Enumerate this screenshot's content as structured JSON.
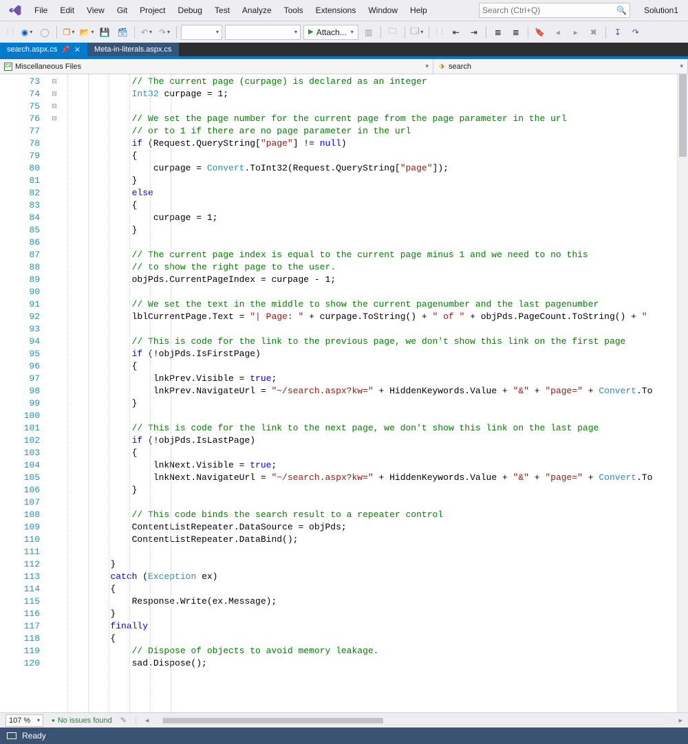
{
  "menu": {
    "items": [
      "File",
      "Edit",
      "View",
      "Git",
      "Project",
      "Debug",
      "Test",
      "Analyze",
      "Tools",
      "Extensions",
      "Window",
      "Help"
    ],
    "search_placeholder": "Search (Ctrl+Q)",
    "solution": "Solution1"
  },
  "toolbar": {
    "attach_label": "Attach..."
  },
  "tabs": [
    {
      "label": "search.aspx.cs",
      "active": true,
      "pinned": true
    },
    {
      "label": "Meta-in-literals.aspx.cs",
      "active": false,
      "pinned": false
    }
  ],
  "nav": {
    "left_label": "Miscellaneous Files",
    "right_label": "search"
  },
  "editor": {
    "first_line": 73,
    "lines": [
      {
        "i": 73,
        "seg": [
          {
            "t": "            ",
            "c": ""
          },
          {
            "t": "// The current page (curpage) is declared as an integer",
            "c": "c-comment"
          }
        ]
      },
      {
        "i": 74,
        "seg": [
          {
            "t": "            ",
            "c": ""
          },
          {
            "t": "Int32",
            "c": "c-type"
          },
          {
            "t": " curpage = ",
            "c": ""
          },
          {
            "t": "1",
            "c": "c-number"
          },
          {
            "t": ";",
            "c": ""
          }
        ]
      },
      {
        "i": 75,
        "seg": [
          {
            "t": "",
            "c": ""
          }
        ]
      },
      {
        "i": 76,
        "seg": [
          {
            "t": "            ",
            "c": ""
          },
          {
            "t": "// We set the page number for the current page from the page parameter in the url",
            "c": "c-comment"
          }
        ]
      },
      {
        "i": 77,
        "seg": [
          {
            "t": "            ",
            "c": ""
          },
          {
            "t": "// or to 1 if there are no page parameter in the url",
            "c": "c-comment"
          }
        ]
      },
      {
        "i": 78,
        "fold": "-",
        "seg": [
          {
            "t": "            ",
            "c": ""
          },
          {
            "t": "if",
            "c": "c-keyword"
          },
          {
            "t": " (Request.QueryString[",
            "c": ""
          },
          {
            "t": "\"page\"",
            "c": "c-string"
          },
          {
            "t": "] != ",
            "c": ""
          },
          {
            "t": "null",
            "c": "c-keyword"
          },
          {
            "t": ")",
            "c": ""
          }
        ]
      },
      {
        "i": 79,
        "seg": [
          {
            "t": "            {",
            "c": ""
          }
        ]
      },
      {
        "i": 80,
        "seg": [
          {
            "t": "                curpage = ",
            "c": ""
          },
          {
            "t": "Convert",
            "c": "c-type"
          },
          {
            "t": ".ToInt32(Request.QueryString[",
            "c": ""
          },
          {
            "t": "\"page\"",
            "c": "c-string"
          },
          {
            "t": "]);",
            "c": ""
          }
        ]
      },
      {
        "i": 81,
        "seg": [
          {
            "t": "            }",
            "c": ""
          }
        ]
      },
      {
        "i": 82,
        "fold": "-",
        "seg": [
          {
            "t": "            ",
            "c": ""
          },
          {
            "t": "else",
            "c": "c-keyword"
          }
        ]
      },
      {
        "i": 83,
        "seg": [
          {
            "t": "            {",
            "c": ""
          }
        ]
      },
      {
        "i": 84,
        "seg": [
          {
            "t": "                curpage = ",
            "c": ""
          },
          {
            "t": "1",
            "c": "c-number"
          },
          {
            "t": ";",
            "c": ""
          }
        ]
      },
      {
        "i": 85,
        "seg": [
          {
            "t": "            }",
            "c": ""
          }
        ]
      },
      {
        "i": 86,
        "seg": [
          {
            "t": "",
            "c": ""
          }
        ]
      },
      {
        "i": 87,
        "seg": [
          {
            "t": "            ",
            "c": ""
          },
          {
            "t": "// The current page index is equal to the current page minus 1 and we need to no this",
            "c": "c-comment"
          }
        ]
      },
      {
        "i": 88,
        "seg": [
          {
            "t": "            ",
            "c": ""
          },
          {
            "t": "// to show the right page to the user.",
            "c": "c-comment"
          }
        ]
      },
      {
        "i": 89,
        "seg": [
          {
            "t": "            objPds.CurrentPageIndex = curpage - ",
            "c": ""
          },
          {
            "t": "1",
            "c": "c-number"
          },
          {
            "t": ";",
            "c": ""
          }
        ]
      },
      {
        "i": 90,
        "seg": [
          {
            "t": "",
            "c": ""
          }
        ]
      },
      {
        "i": 91,
        "seg": [
          {
            "t": "            ",
            "c": ""
          },
          {
            "t": "// We set the text in the middle to show the current pagenumber and the last pagenumber",
            "c": "c-comment"
          }
        ]
      },
      {
        "i": 92,
        "seg": [
          {
            "t": "            lblCurrentPage.Text = ",
            "c": ""
          },
          {
            "t": "\"| Page: \"",
            "c": "c-string"
          },
          {
            "t": " + curpage.ToString() + ",
            "c": ""
          },
          {
            "t": "\" of \"",
            "c": "c-string"
          },
          {
            "t": " + objPds.PageCount.ToString() + ",
            "c": ""
          },
          {
            "t": "\"",
            "c": "c-string"
          }
        ]
      },
      {
        "i": 93,
        "seg": [
          {
            "t": "",
            "c": ""
          }
        ]
      },
      {
        "i": 94,
        "seg": [
          {
            "t": "            ",
            "c": ""
          },
          {
            "t": "// This is code for the link to the previous page, we don't show this link on the first page",
            "c": "c-comment"
          }
        ]
      },
      {
        "i": 95,
        "fold": "-",
        "seg": [
          {
            "t": "            ",
            "c": ""
          },
          {
            "t": "if",
            "c": "c-keyword"
          },
          {
            "t": " (!objPds.IsFirstPage)",
            "c": ""
          }
        ]
      },
      {
        "i": 96,
        "seg": [
          {
            "t": "            {",
            "c": ""
          }
        ]
      },
      {
        "i": 97,
        "seg": [
          {
            "t": "                lnkPrev.Visible = ",
            "c": ""
          },
          {
            "t": "true",
            "c": "c-keyword"
          },
          {
            "t": ";",
            "c": ""
          }
        ]
      },
      {
        "i": 98,
        "seg": [
          {
            "t": "                lnkPrev.NavigateUrl = ",
            "c": ""
          },
          {
            "t": "\"~/search.aspx?kw=\"",
            "c": "c-string"
          },
          {
            "t": " + HiddenKeywords.Value + ",
            "c": ""
          },
          {
            "t": "\"&\"",
            "c": "c-string"
          },
          {
            "t": " + ",
            "c": ""
          },
          {
            "t": "\"page=\"",
            "c": "c-string"
          },
          {
            "t": " + ",
            "c": ""
          },
          {
            "t": "Convert",
            "c": "c-type"
          },
          {
            "t": ".To",
            "c": ""
          }
        ]
      },
      {
        "i": 99,
        "seg": [
          {
            "t": "            }",
            "c": ""
          }
        ]
      },
      {
        "i": 100,
        "seg": [
          {
            "t": "",
            "c": ""
          }
        ]
      },
      {
        "i": 101,
        "seg": [
          {
            "t": "            ",
            "c": ""
          },
          {
            "t": "// This is code for the link to the next page, we don't show this link on the last page",
            "c": "c-comment"
          }
        ]
      },
      {
        "i": 102,
        "fold": "-",
        "seg": [
          {
            "t": "            ",
            "c": ""
          },
          {
            "t": "if",
            "c": "c-keyword"
          },
          {
            "t": " (!objPds.IsLastPage)",
            "c": ""
          }
        ]
      },
      {
        "i": 103,
        "seg": [
          {
            "t": "            {",
            "c": ""
          }
        ]
      },
      {
        "i": 104,
        "seg": [
          {
            "t": "                lnkNext.Visible = ",
            "c": ""
          },
          {
            "t": "true",
            "c": "c-keyword"
          },
          {
            "t": ";",
            "c": ""
          }
        ]
      },
      {
        "i": 105,
        "seg": [
          {
            "t": "                lnkNext.NavigateUrl = ",
            "c": ""
          },
          {
            "t": "\"~/search.aspx?kw=\"",
            "c": "c-string"
          },
          {
            "t": " + HiddenKeywords.Value + ",
            "c": ""
          },
          {
            "t": "\"&\"",
            "c": "c-string"
          },
          {
            "t": " + ",
            "c": ""
          },
          {
            "t": "\"page=\"",
            "c": "c-string"
          },
          {
            "t": " + ",
            "c": ""
          },
          {
            "t": "Convert",
            "c": "c-type"
          },
          {
            "t": ".To",
            "c": ""
          }
        ]
      },
      {
        "i": 106,
        "seg": [
          {
            "t": "            }",
            "c": ""
          }
        ]
      },
      {
        "i": 107,
        "seg": [
          {
            "t": "",
            "c": ""
          }
        ]
      },
      {
        "i": 108,
        "seg": [
          {
            "t": "            ",
            "c": ""
          },
          {
            "t": "// This code binds the search result to a repeater control",
            "c": "c-comment"
          }
        ]
      },
      {
        "i": 109,
        "seg": [
          {
            "t": "            ContentListRepeater.DataSource = objPds;",
            "c": ""
          }
        ]
      },
      {
        "i": 110,
        "seg": [
          {
            "t": "            ContentListRepeater.DataBind();",
            "c": ""
          }
        ]
      },
      {
        "i": 111,
        "seg": [
          {
            "t": "",
            "c": ""
          }
        ]
      },
      {
        "i": 112,
        "seg": [
          {
            "t": "        }",
            "c": ""
          }
        ]
      },
      {
        "i": 113,
        "seg": [
          {
            "t": "        ",
            "c": ""
          },
          {
            "t": "catch",
            "c": "c-keyword"
          },
          {
            "t": " (",
            "c": ""
          },
          {
            "t": "Exception",
            "c": "c-type"
          },
          {
            "t": " ex)",
            "c": ""
          }
        ]
      },
      {
        "i": 114,
        "seg": [
          {
            "t": "        {",
            "c": ""
          }
        ]
      },
      {
        "i": 115,
        "seg": [
          {
            "t": "            Response.Write(ex.Message);",
            "c": ""
          }
        ]
      },
      {
        "i": 116,
        "seg": [
          {
            "t": "        }",
            "c": ""
          }
        ]
      },
      {
        "i": 117,
        "seg": [
          {
            "t": "        ",
            "c": ""
          },
          {
            "t": "finally",
            "c": "c-keyword"
          }
        ]
      },
      {
        "i": 118,
        "seg": [
          {
            "t": "        {",
            "c": ""
          }
        ]
      },
      {
        "i": 119,
        "seg": [
          {
            "t": "            ",
            "c": ""
          },
          {
            "t": "// Dispose of objects to avoid memory leakage.",
            "c": "c-comment"
          }
        ]
      },
      {
        "i": 120,
        "seg": [
          {
            "t": "            sad.Dispose();",
            "c": ""
          }
        ]
      }
    ]
  },
  "status_top": {
    "zoom": "107 %",
    "issues": "No issues found"
  },
  "status_bar": {
    "ready": "Ready"
  }
}
